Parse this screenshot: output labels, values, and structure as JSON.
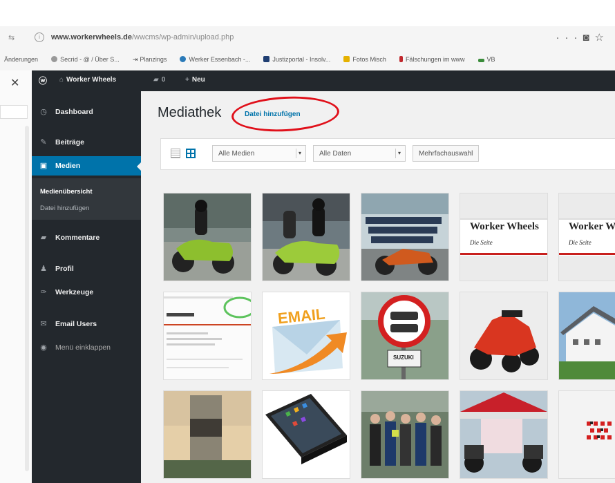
{
  "browser": {
    "url_domain": "www.workerwheels.de",
    "url_path": "/wwcms/wp-admin/upload.php",
    "bookmarks": [
      "Änderungen",
      "Secrid - @ / Über S...",
      "Planzings",
      "Werker Essenbach -...",
      "Justizportal - Insolv...",
      "Fotos Misch",
      "Fälschungen im www",
      "VB"
    ]
  },
  "adminbar": {
    "site_name": "Worker Wheels",
    "comments_count": "0",
    "new_label": "Neu"
  },
  "sidebar": {
    "items": [
      {
        "label": "Dashboard",
        "icon": "dashboard-icon"
      },
      {
        "label": "Beiträge",
        "icon": "pin-icon"
      },
      {
        "label": "Medien",
        "icon": "media-icon"
      },
      {
        "label": "Kommentare",
        "icon": "comment-icon"
      },
      {
        "label": "Profil",
        "icon": "user-icon"
      },
      {
        "label": "Werkzeuge",
        "icon": "wrench-icon"
      },
      {
        "label": "Email Users",
        "icon": "email-icon"
      },
      {
        "label": "Menü einklappen",
        "icon": "collapse-icon"
      }
    ],
    "submenu": [
      "Medienübersicht",
      "Datei hinzufügen"
    ]
  },
  "page": {
    "title": "Mediathek",
    "add_new": "Datei hinzufügen"
  },
  "toolbar": {
    "filter_media": "Alle Medien",
    "filter_dates": "Alle Daten",
    "bulk_select": "Mehrfachauswahl"
  },
  "media": {
    "banner_text": "Worker Wheels",
    "banner_subtext": "Die Seite",
    "email_text": "EMAIL",
    "sign_text": "SUZUKI",
    "tiles": [
      "scooter-green-rider",
      "scooter-green-two-riders",
      "motorcycle-text-overlay",
      "banner-worker-wheels",
      "banner-worker-wheels-2",
      "website-screenshot",
      "email-graphic",
      "prohibition-sign",
      "red-three-wheel-scooter",
      "hotel-building",
      "tower-building",
      "smartphone-graphic",
      "group-photo",
      "event-tent",
      "red-pattern"
    ]
  },
  "colors": {
    "adminbar": "#23282d",
    "active": "#0073aa",
    "annotation": "#e0101a"
  }
}
